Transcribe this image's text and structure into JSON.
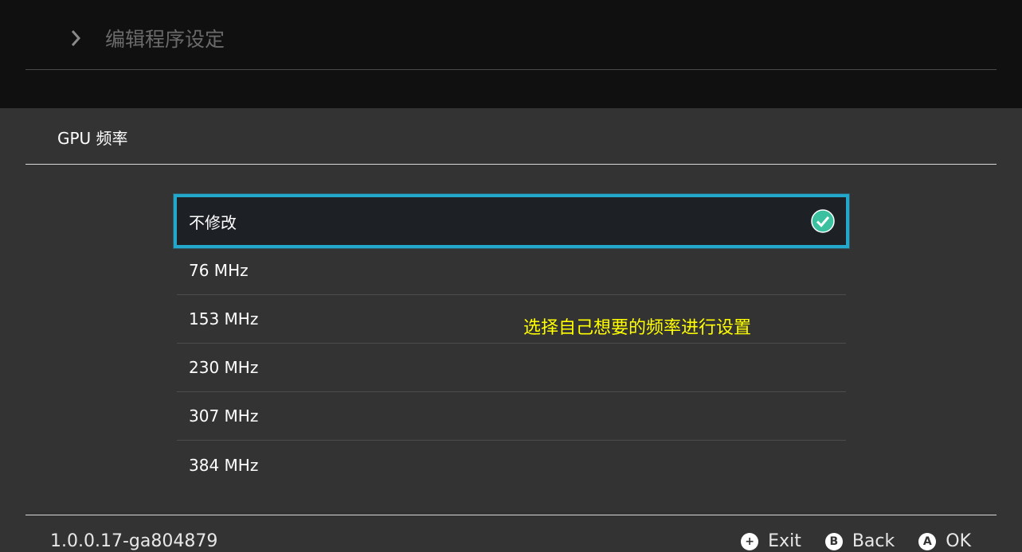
{
  "header": {
    "title": "编辑程序设定"
  },
  "panel": {
    "title": "GPU 频率",
    "options": [
      {
        "label": "不修改",
        "selected": true
      },
      {
        "label": "76 MHz",
        "selected": false
      },
      {
        "label": "153 MHz",
        "selected": false
      },
      {
        "label": "230 MHz",
        "selected": false
      },
      {
        "label": "307 MHz",
        "selected": false
      },
      {
        "label": "384 MHz",
        "selected": false
      }
    ],
    "hint": "选择自己想要的频率进行设置"
  },
  "footer": {
    "version": "1.0.0.17-ga804879",
    "exit_label": "Exit",
    "back_label": "Back",
    "ok_label": "OK",
    "exit_glyph": "+",
    "back_glyph": "B",
    "ok_glyph": "A"
  },
  "colors": {
    "accent": "#23a8cc",
    "check": "#3cc1a0",
    "hint": "#ffff00"
  }
}
